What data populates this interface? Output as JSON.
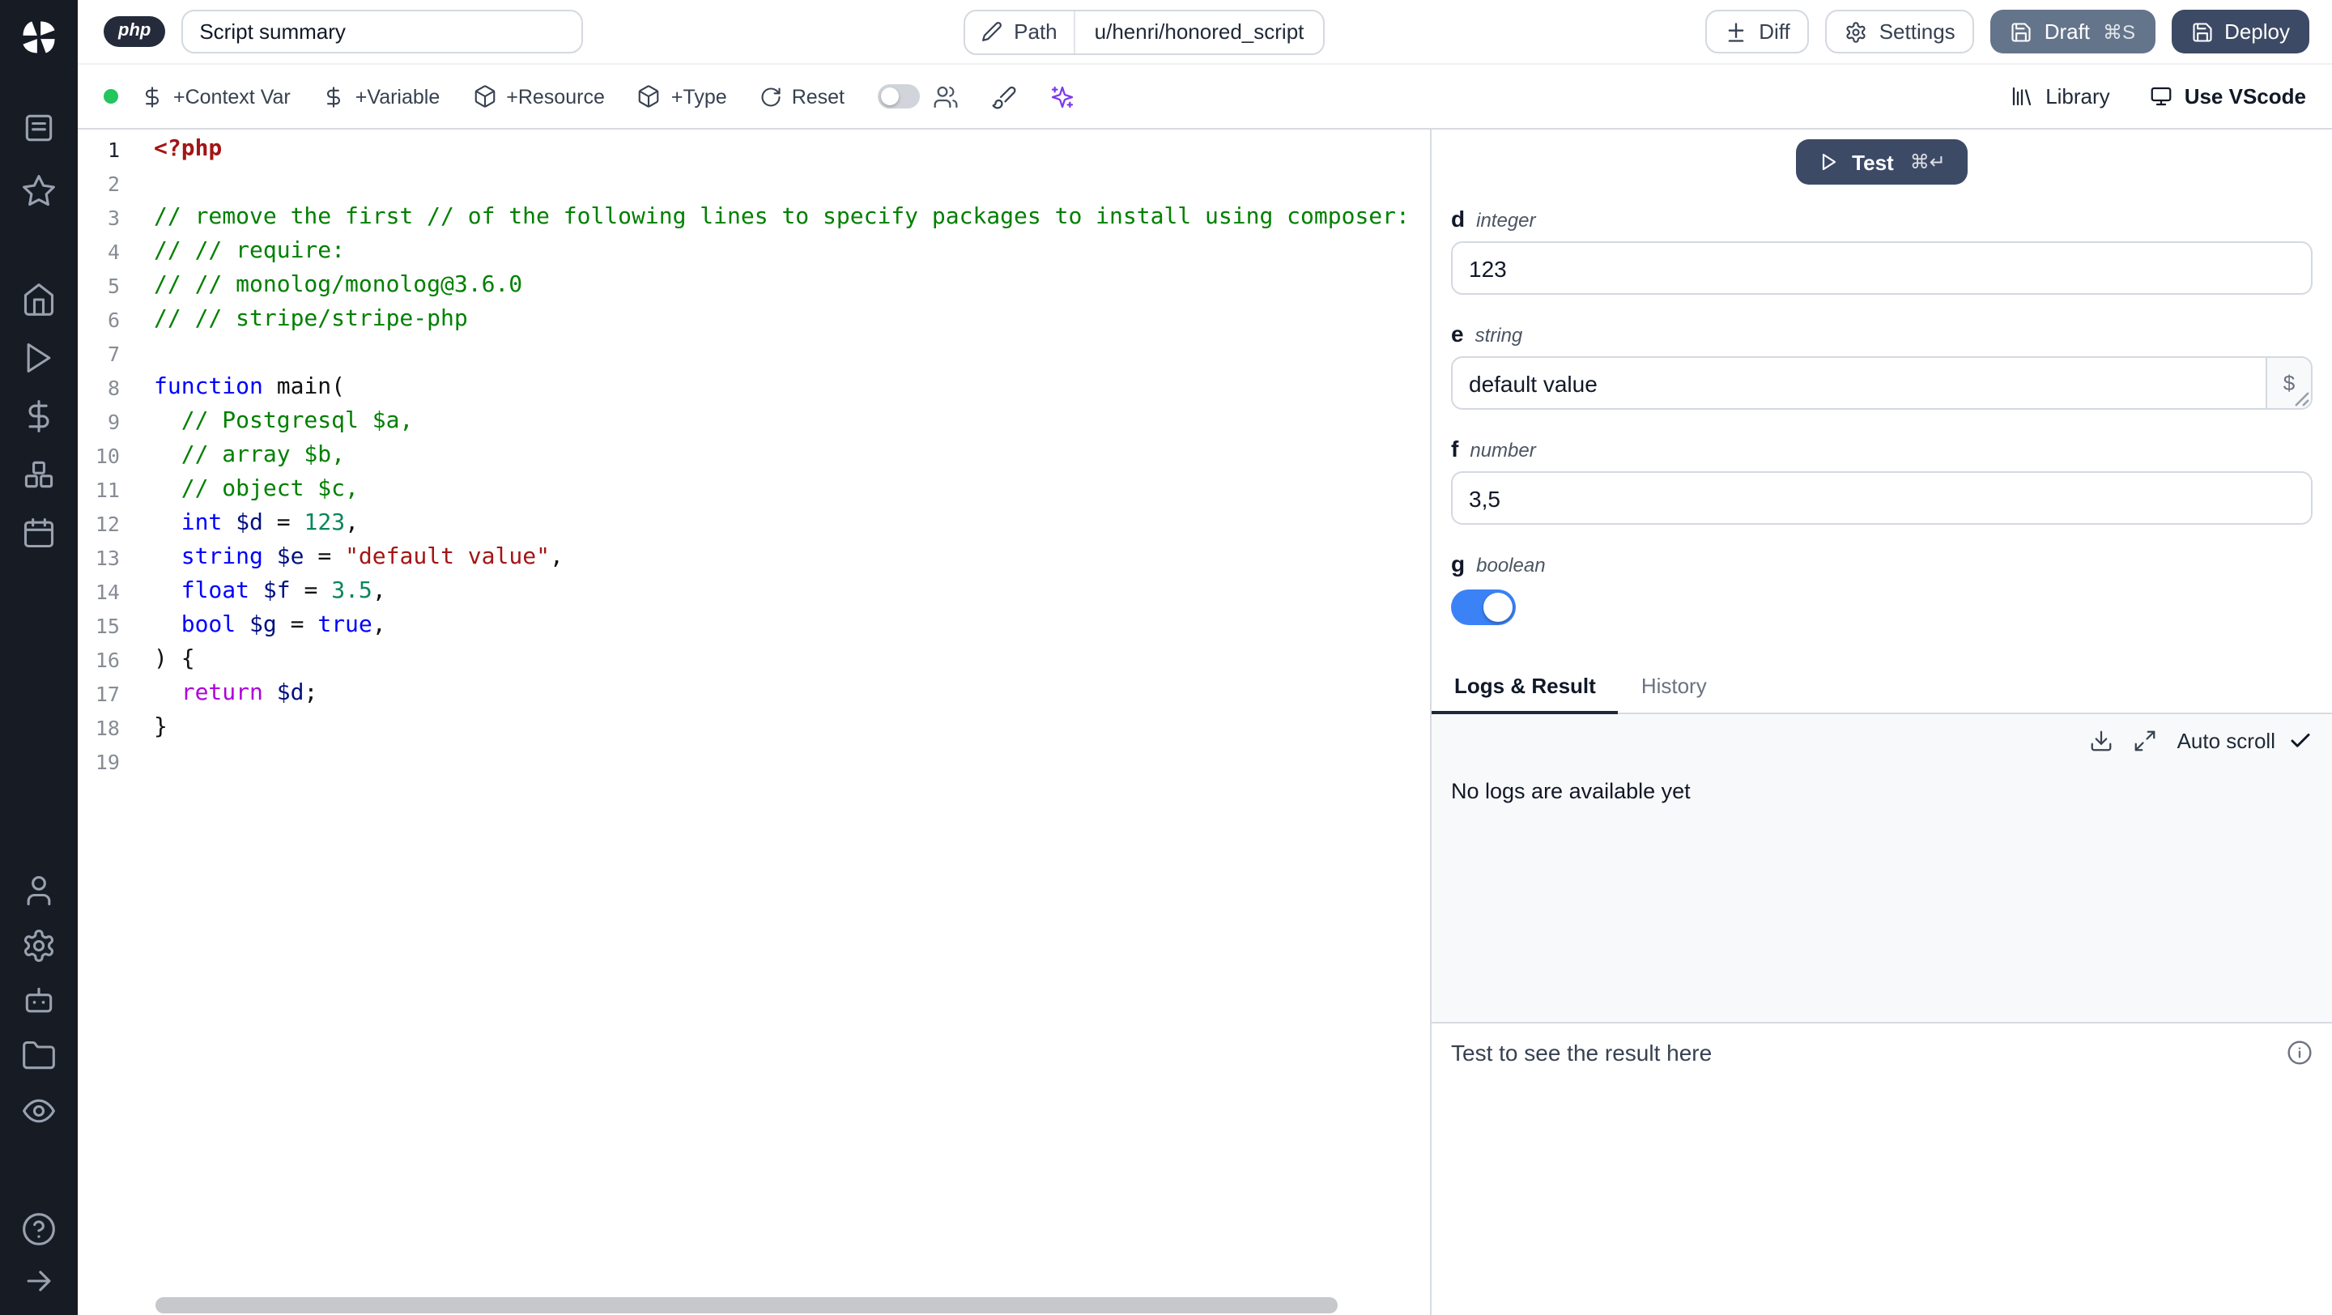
{
  "sidebar": {
    "icons": [
      "windmill-logo",
      "notebook",
      "favorites-star",
      "home",
      "runs-play",
      "variables-dollar",
      "resources-boxes",
      "schedules-calendar",
      "user",
      "settings-gear",
      "workers-bot",
      "folders",
      "audit-eye",
      "help",
      "expand-arrow"
    ]
  },
  "header": {
    "lang_badge": "php",
    "summary_value": "Script summary",
    "path": {
      "label": "Path",
      "value": "u/henri/honored_script"
    },
    "buttons": {
      "diff": "Diff",
      "settings": "Settings",
      "draft": "Draft",
      "draft_shortcut": "⌘S",
      "deploy": "Deploy"
    }
  },
  "toolbar": {
    "buttons": [
      {
        "icon": "dollar",
        "label": "+Context Var"
      },
      {
        "icon": "dollar",
        "label": "+Variable"
      },
      {
        "icon": "package",
        "label": "+Resource"
      },
      {
        "icon": "package",
        "label": "+Type"
      },
      {
        "icon": "reset",
        "label": "Reset"
      }
    ],
    "library": "Library",
    "vscode": "Use VScode"
  },
  "editor": {
    "lines": [
      {
        "n": "1",
        "a": true,
        "s": [
          [
            "meta",
            "<?php"
          ]
        ]
      },
      {
        "n": "2",
        "s": []
      },
      {
        "n": "3",
        "s": [
          [
            "com",
            "// remove the first // of the following lines to specify packages to install using composer:"
          ]
        ]
      },
      {
        "n": "4",
        "s": [
          [
            "com",
            "// // require:"
          ]
        ]
      },
      {
        "n": "5",
        "s": [
          [
            "com",
            "// // monolog/monolog@3.6.0"
          ]
        ]
      },
      {
        "n": "6",
        "s": [
          [
            "com",
            "// // stripe/stripe-php"
          ]
        ]
      },
      {
        "n": "7",
        "s": []
      },
      {
        "n": "8",
        "s": [
          [
            "kw",
            "function"
          ],
          [
            "pl",
            " main("
          ]
        ]
      },
      {
        "n": "9",
        "s": [
          [
            "com",
            "  // Postgresql $a,"
          ]
        ]
      },
      {
        "n": "10",
        "s": [
          [
            "com",
            "  // array $b,"
          ]
        ]
      },
      {
        "n": "11",
        "s": [
          [
            "com",
            "  // object $c,"
          ]
        ]
      },
      {
        "n": "12",
        "s": [
          [
            "pl",
            "  "
          ],
          [
            "kw",
            "int"
          ],
          [
            "pl",
            " "
          ],
          [
            "var",
            "$d"
          ],
          [
            "pl",
            " = "
          ],
          [
            "num",
            "123"
          ],
          [
            "pl",
            ","
          ]
        ]
      },
      {
        "n": "13",
        "s": [
          [
            "pl",
            "  "
          ],
          [
            "kw",
            "string"
          ],
          [
            "pl",
            " "
          ],
          [
            "var",
            "$e"
          ],
          [
            "pl",
            " = "
          ],
          [
            "str",
            "\"default value\""
          ],
          [
            "pl",
            ","
          ]
        ]
      },
      {
        "n": "14",
        "s": [
          [
            "pl",
            "  "
          ],
          [
            "kw",
            "float"
          ],
          [
            "pl",
            " "
          ],
          [
            "var",
            "$f"
          ],
          [
            "pl",
            " = "
          ],
          [
            "num",
            "3.5"
          ],
          [
            "pl",
            ","
          ]
        ]
      },
      {
        "n": "15",
        "s": [
          [
            "pl",
            "  "
          ],
          [
            "kw",
            "bool"
          ],
          [
            "pl",
            " "
          ],
          [
            "var",
            "$g"
          ],
          [
            "pl",
            " = "
          ],
          [
            "kw",
            "true"
          ],
          [
            "pl",
            ","
          ]
        ]
      },
      {
        "n": "16",
        "s": [
          [
            "pl",
            ") {"
          ]
        ]
      },
      {
        "n": "17",
        "s": [
          [
            "pl",
            "  "
          ],
          [
            "ctl",
            "return"
          ],
          [
            "pl",
            " "
          ],
          [
            "var",
            "$d"
          ],
          [
            "pl",
            ";"
          ]
        ]
      },
      {
        "n": "18",
        "s": [
          [
            "pl",
            "}"
          ]
        ]
      },
      {
        "n": "19",
        "s": []
      }
    ]
  },
  "runner": {
    "test": {
      "label": "Test",
      "shortcut": "⌘↵"
    },
    "insert_var_label": "$",
    "fields": [
      {
        "name": "d",
        "type": "integer",
        "value": "123"
      },
      {
        "name": "e",
        "type": "string",
        "value": "default value"
      },
      {
        "name": "f",
        "type": "number",
        "value": "3,5"
      },
      {
        "name": "g",
        "type": "boolean",
        "value": "on"
      }
    ],
    "tabs": {
      "logs": "Logs & Result",
      "history": "History"
    },
    "auto_scroll": "Auto scroll",
    "logs_empty": "No logs are available yet",
    "result_placeholder": "Test to see the result here"
  },
  "colors": {
    "status_green": "#22c55e",
    "draft": "#64748b",
    "deploy": "#3d4a66",
    "toggle": "#3b82f6",
    "ai": "#7c3aed",
    "accent_dark": "#1f2937"
  }
}
